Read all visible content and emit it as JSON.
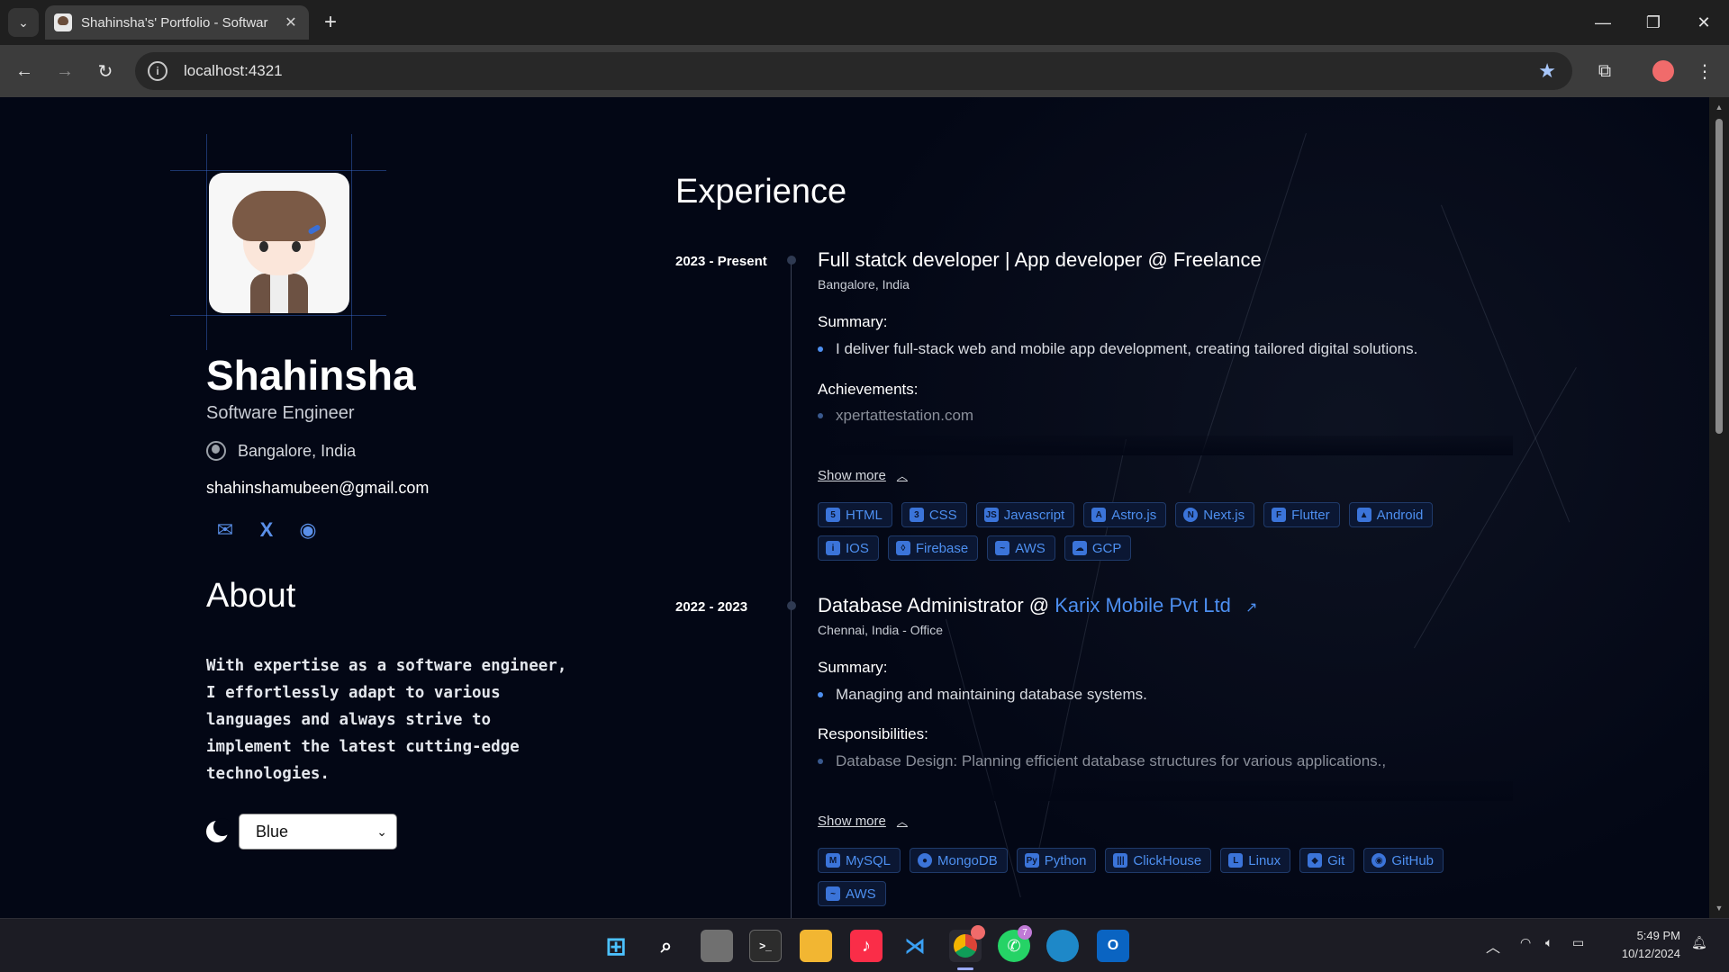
{
  "browser": {
    "tab_title": "Shahinsha's' Portfolio - Softwar",
    "url": "localhost:4321",
    "accent": "#a8c7fa"
  },
  "profile": {
    "name": "Shahinsha",
    "role": "Software Engineer",
    "location": "Bangalore, India",
    "email": "shahinshamubeen@gmail.com"
  },
  "about": {
    "heading": "About",
    "text": "With expertise as a software engineer, I effortlessly adapt to various languages and always strive to implement the latest cutting-edge technologies."
  },
  "theme": {
    "selected": "Blue"
  },
  "experience": {
    "heading": "Experience",
    "jobs": [
      {
        "date": "2023 - Present",
        "title": "Full statck developer | App developer @ Freelance",
        "subtitle": "Bangalore, India",
        "summary_h": "Summary:",
        "summary": "I deliver full-stack web and mobile app development, creating tailored digital solutions.",
        "second_h": "Achievements:",
        "second": "xpertattestation.com",
        "show_more": "Show more",
        "skills": [
          "HTML",
          "CSS",
          "Javascript",
          "Astro.js",
          "Next.js",
          "Flutter",
          "Android",
          "IOS",
          "Firebase",
          "AWS",
          "GCP"
        ]
      },
      {
        "date": "2022 - 2023",
        "title_prefix": "Database Administrator @ ",
        "company": "Karix Mobile Pvt Ltd",
        "subtitle": "Chennai, India - Office",
        "summary_h": "Summary:",
        "summary": "Managing and maintaining database systems.",
        "second_h": "Responsibilities:",
        "second": "Database Design: Planning efficient database structures for various applications.,",
        "show_more": "Show more",
        "skills": [
          "MySQL",
          "MongoDB",
          "Python",
          "ClickHouse",
          "Linux",
          "Git",
          "GitHub",
          "AWS"
        ]
      }
    ]
  },
  "taskbar": {
    "time": "5:49 PM",
    "date": "10/12/2024",
    "whatsapp_badge": "7"
  },
  "colors": {
    "page_bg": "#030715",
    "accent_blue": "#4d8ff0"
  }
}
